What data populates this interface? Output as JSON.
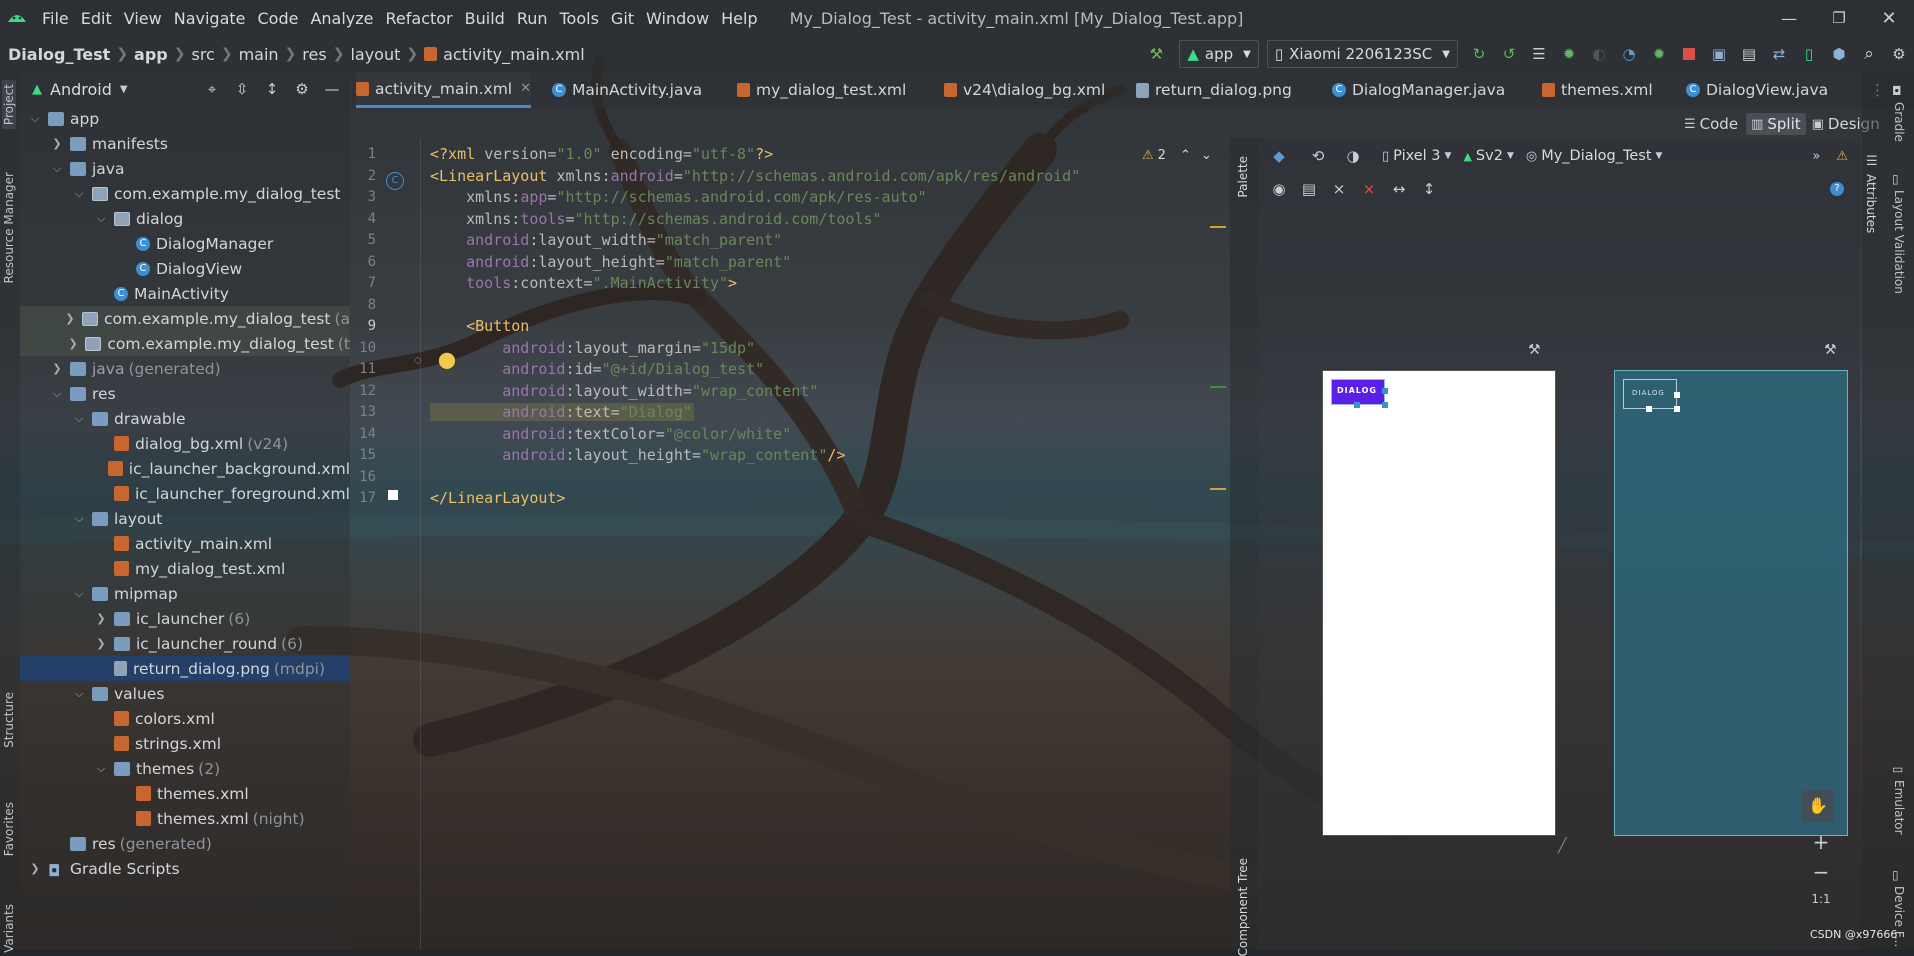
{
  "menu": {
    "items": [
      "File",
      "Edit",
      "View",
      "Navigate",
      "Code",
      "Analyze",
      "Refactor",
      "Build",
      "Run",
      "Tools",
      "Git",
      "Window",
      "Help"
    ],
    "window_title": "My_Dialog_Test - activity_main.xml [My_Dialog_Test.app]"
  },
  "breadcrumb": [
    "Dialog_Test",
    "app",
    "src",
    "main",
    "res",
    "layout",
    "activity_main.xml"
  ],
  "toolbar": {
    "run_config": "app",
    "device": "Xiaomi 2206123SC"
  },
  "left_strip": {
    "project": "Project",
    "resource_manager": "Resource Manager",
    "structure": "Structure",
    "favorites": "Favorites",
    "variants": "Variants"
  },
  "project_panel": {
    "view_mode": "Android",
    "tree": [
      {
        "label": "app",
        "suffix": "",
        "type": "folder",
        "depth": 0,
        "expanded": true
      },
      {
        "label": "manifests",
        "suffix": "",
        "type": "folder",
        "depth": 1,
        "expanded": false
      },
      {
        "label": "java",
        "suffix": "",
        "type": "folder",
        "depth": 1,
        "expanded": true
      },
      {
        "label": "com.example.my_dialog_test",
        "suffix": "",
        "type": "package",
        "depth": 2,
        "expanded": true
      },
      {
        "label": "dialog",
        "suffix": "",
        "type": "package",
        "depth": 3,
        "expanded": true
      },
      {
        "label": "DialogManager",
        "suffix": "",
        "type": "class",
        "depth": 4,
        "expanded": null
      },
      {
        "label": "DialogView",
        "suffix": "",
        "type": "class",
        "depth": 4,
        "expanded": null
      },
      {
        "label": "MainActivity",
        "suffix": "",
        "type": "class",
        "depth": 3,
        "expanded": null
      },
      {
        "label": "com.example.my_dialog_test",
        "suffix": "(a",
        "type": "package",
        "depth": 2,
        "expanded": false
      },
      {
        "label": "com.example.my_dialog_test",
        "suffix": "(t",
        "type": "package",
        "depth": 2,
        "expanded": false
      },
      {
        "label": "java",
        "suffix": "(generated)",
        "type": "folder",
        "depth": 1,
        "expanded": false
      },
      {
        "label": "res",
        "suffix": "",
        "type": "folder",
        "depth": 1,
        "expanded": true
      },
      {
        "label": "drawable",
        "suffix": "",
        "type": "folder",
        "depth": 2,
        "expanded": true
      },
      {
        "label": "dialog_bg.xml",
        "suffix": "(v24)",
        "type": "xml",
        "depth": 3,
        "expanded": null
      },
      {
        "label": "ic_launcher_background.xml",
        "suffix": "",
        "type": "xml",
        "depth": 3,
        "expanded": null
      },
      {
        "label": "ic_launcher_foreground.xml",
        "suffix": "",
        "type": "xml",
        "depth": 3,
        "expanded": null
      },
      {
        "label": "layout",
        "suffix": "",
        "type": "folder",
        "depth": 2,
        "expanded": true
      },
      {
        "label": "activity_main.xml",
        "suffix": "",
        "type": "xml",
        "depth": 3,
        "expanded": null
      },
      {
        "label": "my_dialog_test.xml",
        "suffix": "",
        "type": "xml",
        "depth": 3,
        "expanded": null
      },
      {
        "label": "mipmap",
        "suffix": "",
        "type": "folder",
        "depth": 2,
        "expanded": true
      },
      {
        "label": "ic_launcher",
        "suffix": "(6)",
        "type": "folder",
        "depth": 3,
        "expanded": false
      },
      {
        "label": "ic_launcher_round",
        "suffix": "(6)",
        "type": "folder",
        "depth": 3,
        "expanded": false
      },
      {
        "label": "return_dialog.png",
        "suffix": "(mdpi)",
        "type": "png",
        "depth": 3,
        "expanded": null
      },
      {
        "label": "values",
        "suffix": "",
        "type": "folder",
        "depth": 2,
        "expanded": true
      },
      {
        "label": "colors.xml",
        "suffix": "",
        "type": "xml",
        "depth": 3,
        "expanded": null
      },
      {
        "label": "strings.xml",
        "suffix": "",
        "type": "xml",
        "depth": 3,
        "expanded": null
      },
      {
        "label": "themes",
        "suffix": "(2)",
        "type": "folder",
        "depth": 3,
        "expanded": true
      },
      {
        "label": "themes.xml",
        "suffix": "",
        "type": "xml",
        "depth": 4,
        "expanded": null
      },
      {
        "label": "themes.xml",
        "suffix": "(night)",
        "type": "xml",
        "depth": 4,
        "expanded": null
      },
      {
        "label": "res",
        "suffix": "(generated)",
        "type": "folder",
        "depth": 1,
        "expanded": null
      },
      {
        "label": "Gradle Scripts",
        "suffix": "",
        "type": "gradle",
        "depth": 0,
        "expanded": false
      }
    ],
    "selected_index": 22
  },
  "tabs": [
    {
      "label": "activity_main.xml",
      "icon": "xml",
      "active": true,
      "closable": true
    },
    {
      "label": "MainActivity.java",
      "icon": "class",
      "active": false,
      "closable": false
    },
    {
      "label": "my_dialog_test.xml",
      "icon": "xml",
      "active": false,
      "closable": false
    },
    {
      "label": "v24\\dialog_bg.xml",
      "icon": "xml",
      "active": false,
      "closable": false
    },
    {
      "label": "return_dialog.png",
      "icon": "png",
      "active": false,
      "closable": false
    },
    {
      "label": "DialogManager.java",
      "icon": "class",
      "active": false,
      "closable": false
    },
    {
      "label": "themes.xml",
      "icon": "xml",
      "active": false,
      "closable": false
    },
    {
      "label": "DialogView.java",
      "icon": "class",
      "active": false,
      "closable": false
    }
  ],
  "mode": {
    "code": "Code",
    "split": "Split",
    "design": "Design"
  },
  "editor": {
    "warnings": "2",
    "lines": [
      {
        "n": "1",
        "segs": [
          [
            "tag",
            "<?xml "
          ],
          [
            "attr",
            "version="
          ],
          [
            "val",
            "\"1.0\""
          ],
          [
            "attr",
            " encoding="
          ],
          [
            "val",
            "\"utf-8\""
          ],
          [
            "tag",
            "?>"
          ]
        ]
      },
      {
        "n": "2",
        "segs": [
          [
            "tag",
            "<LinearLayout "
          ],
          [
            "attr",
            "xmlns:"
          ],
          [
            "ns",
            "android"
          ],
          [
            "attr",
            "="
          ],
          [
            "val",
            "\"http://schemas.android.com/apk/res/android\""
          ]
        ]
      },
      {
        "n": "3",
        "segs": [
          [
            "attr",
            "    xmlns:"
          ],
          [
            "ns",
            "app"
          ],
          [
            "attr",
            "="
          ],
          [
            "val",
            "\"http://schemas.android.com/apk/res-auto\""
          ]
        ]
      },
      {
        "n": "4",
        "segs": [
          [
            "attr",
            "    xmlns:"
          ],
          [
            "ns",
            "tools"
          ],
          [
            "attr",
            "="
          ],
          [
            "val",
            "\"http://schemas.android.com/tools\""
          ]
        ]
      },
      {
        "n": "5",
        "segs": [
          [
            "ns",
            "    android"
          ],
          [
            "attr",
            ":layout_width="
          ],
          [
            "val",
            "\"match_parent\""
          ]
        ]
      },
      {
        "n": "6",
        "segs": [
          [
            "ns",
            "    android"
          ],
          [
            "attr",
            ":layout_height="
          ],
          [
            "val",
            "\"match_parent\""
          ]
        ]
      },
      {
        "n": "7",
        "segs": [
          [
            "ns",
            "    tools"
          ],
          [
            "attr",
            ":context="
          ],
          [
            "val",
            "\".MainActivity\""
          ],
          [
            "tag",
            ">"
          ]
        ]
      },
      {
        "n": "8",
        "segs": []
      },
      {
        "n": "9",
        "segs": [
          [
            "tag",
            "    <Button"
          ]
        ]
      },
      {
        "n": "10",
        "segs": [
          [
            "ns",
            "        android"
          ],
          [
            "attr",
            ":layout_margin="
          ],
          [
            "val",
            "\"15dp\""
          ]
        ]
      },
      {
        "n": "11",
        "segs": [
          [
            "ns",
            "        android"
          ],
          [
            "attr",
            ":id="
          ],
          [
            "val",
            "\"@+id/Dialog_test\""
          ]
        ]
      },
      {
        "n": "12",
        "segs": [
          [
            "ns",
            "        android"
          ],
          [
            "attr",
            ":layout_width="
          ],
          [
            "val",
            "\"wrap_content\""
          ]
        ]
      },
      {
        "n": "13",
        "segs": [
          [
            "ns",
            "        android"
          ],
          [
            "attr",
            ":text="
          ],
          [
            "val",
            "\"Dialog\""
          ]
        ]
      },
      {
        "n": "14",
        "segs": [
          [
            "ns",
            "        android"
          ],
          [
            "attr",
            ":textColor="
          ],
          [
            "val",
            "\"@color/white\""
          ]
        ]
      },
      {
        "n": "15",
        "segs": [
          [
            "ns",
            "        android"
          ],
          [
            "attr",
            ":layout_height="
          ],
          [
            "val",
            "\"wrap_content\""
          ],
          [
            "tag",
            "/>"
          ]
        ]
      },
      {
        "n": "16",
        "segs": []
      },
      {
        "n": "17",
        "segs": [
          [
            "tag",
            "</LinearLayout>"
          ]
        ]
      }
    ]
  },
  "design": {
    "device": "Pixel 3",
    "api": "Sv2",
    "theme": "My_Dialog_Test",
    "button_text": "DIALOG",
    "zoom": "1:1",
    "palette": "Palette",
    "component_tree": "Component Tree"
  },
  "right_strip": {
    "gradle": "Gradle",
    "attributes": "Attributes",
    "layout_validation": "Layout Validation",
    "emulator": "Emulator",
    "device_file": "Device F..."
  },
  "watermark": "CSDN @x97666",
  "colors": {
    "accent": "#4a88c7",
    "selection": "#214273",
    "button": "#5b1fe8",
    "android_green": "#3ddc84"
  }
}
